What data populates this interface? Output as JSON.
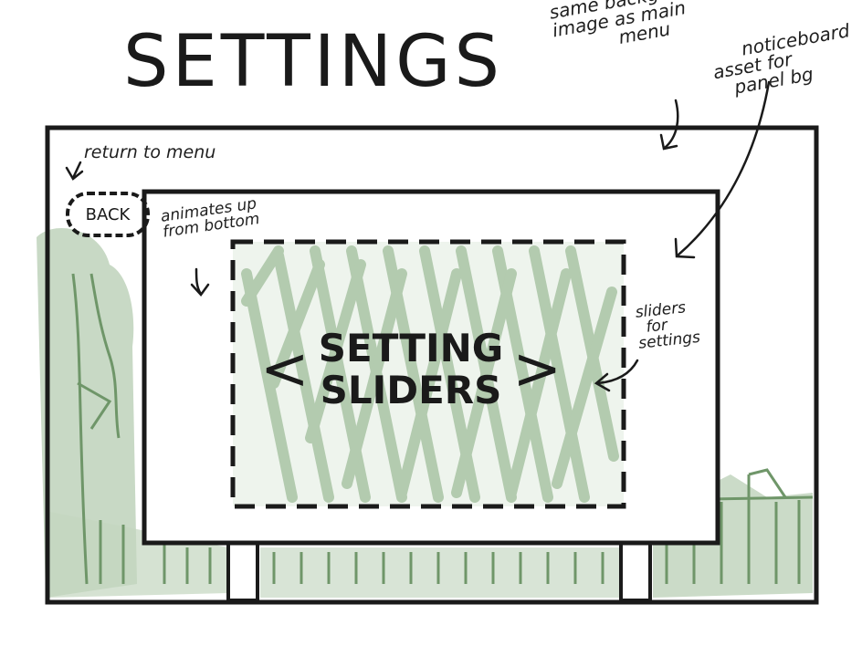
{
  "title": "SETTINGS",
  "annotations": {
    "background": [
      "same background",
      "image as main",
      "menu"
    ],
    "noticeboard": [
      "noticeboard",
      "asset for",
      "panel bg"
    ],
    "return": "return to menu",
    "animate": [
      "animates up",
      "from bottom"
    ],
    "sliders": [
      "sliders",
      "for",
      "settings"
    ]
  },
  "back_button": "BACK",
  "panel": {
    "line1": "SETTING",
    "line2": "SLIDERS",
    "left_chevron": "<",
    "right_chevron": ">"
  },
  "colors": {
    "ink": "#1a1a1a",
    "foliage": "#8fae8a",
    "foliage_dark": "#5f8a5a",
    "hatch": "#a9c4a5"
  }
}
